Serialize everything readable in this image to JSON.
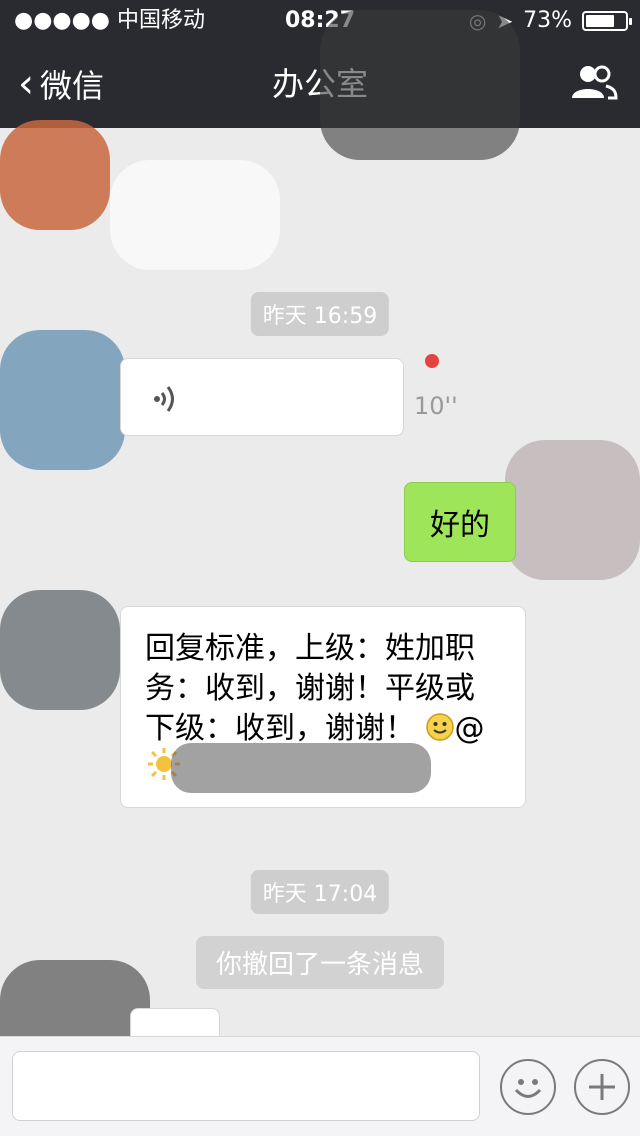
{
  "status_bar": {
    "signal": "●●●●● 中国移动",
    "time": "08:27",
    "battery": "73%",
    "battery_level": 0.73
  },
  "nav": {
    "back_label": "微信",
    "title": "办公室"
  },
  "chat": {
    "time_1": "昨天 16:59",
    "voice_duration": "10''",
    "my_reply": "好的",
    "text_message": "回复标准，上级：姓加职务：收到，谢谢！平级或下级：收到，谢谢！",
    "mention": "@",
    "time_2": "昨天 17:04",
    "recall_notice": "你撤回了一条消息"
  },
  "icons": {
    "back": "chevron-left-icon",
    "contacts": "people-icon",
    "voice": "sound-wave-icon",
    "emoji": "smile-icon",
    "plus": "plus-icon"
  },
  "colors": {
    "nav_bg": "#2a2b30",
    "chat_bg": "#ebebeb",
    "my_bubble": "#9fe55a",
    "unread_dot": "#e64340"
  }
}
